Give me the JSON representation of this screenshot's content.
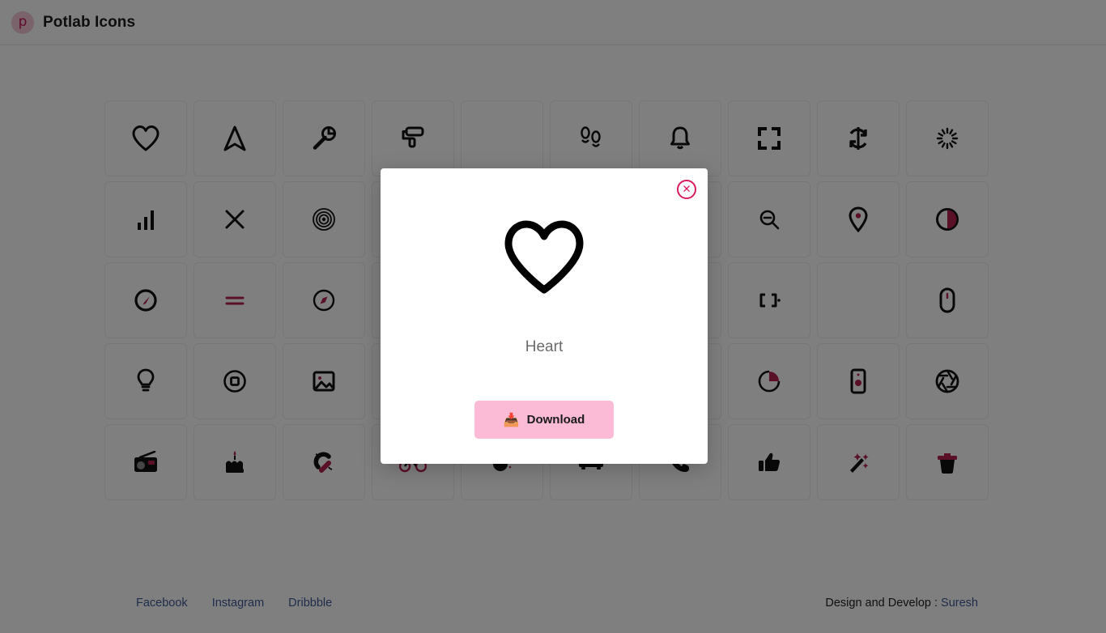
{
  "header": {
    "brand_mark": "p",
    "brand_mark_icon": "potlab-logo-icon",
    "title": "Potlab Icons"
  },
  "colors": {
    "accent_pink": "#d81b60",
    "button_pink": "#fbbbd6",
    "link_blue": "#3d5a99",
    "icon_dark": "#111111",
    "logo_bg": "#f4c6d4"
  },
  "grid": {
    "columns": 10,
    "rows": 5,
    "cells": [
      {
        "name": "heart-icon",
        "icon": "heart"
      },
      {
        "name": "navigation-icon",
        "icon": "navigation"
      },
      {
        "name": "wrench-icon",
        "icon": "wrench"
      },
      {
        "name": "paint-roller-icon",
        "icon": "paint-roller"
      },
      {
        "name": "empty-cell",
        "icon": "none"
      },
      {
        "name": "footprints-icon",
        "icon": "footprints"
      },
      {
        "name": "bell-icon",
        "icon": "bell"
      },
      {
        "name": "fullscreen-icon",
        "icon": "fullscreen"
      },
      {
        "name": "refresh-icon",
        "icon": "refresh"
      },
      {
        "name": "loading-spinner-icon",
        "icon": "loading"
      },
      {
        "name": "bar-chart-icon",
        "icon": "bar-chart"
      },
      {
        "name": "close-x-icon",
        "icon": "close-x"
      },
      {
        "name": "vinyl-record-icon",
        "icon": "vinyl"
      },
      {
        "name": "hidden-cell",
        "icon": "none"
      },
      {
        "name": "hidden-cell",
        "icon": "none"
      },
      {
        "name": "hidden-cell",
        "icon": "none"
      },
      {
        "name": "hidden-cell",
        "icon": "none"
      },
      {
        "name": "zoom-out-icon",
        "icon": "zoom-out"
      },
      {
        "name": "map-pin-icon",
        "icon": "map-pin"
      },
      {
        "name": "contrast-icon",
        "icon": "contrast"
      },
      {
        "name": "speedometer-icon",
        "icon": "speedometer"
      },
      {
        "name": "equals-icon",
        "icon": "equals"
      },
      {
        "name": "compass-icon",
        "icon": "compass"
      },
      {
        "name": "hidden-cell",
        "icon": "none"
      },
      {
        "name": "hidden-cell",
        "icon": "none"
      },
      {
        "name": "hidden-cell",
        "icon": "none"
      },
      {
        "name": "hidden-cell",
        "icon": "none"
      },
      {
        "name": "code-brackets-icon",
        "icon": "brackets"
      },
      {
        "name": "empty-cell",
        "icon": "none"
      },
      {
        "name": "mouse-icon",
        "icon": "mouse"
      },
      {
        "name": "lightbulb-icon",
        "icon": "bulb"
      },
      {
        "name": "record-stop-icon",
        "icon": "record-stop"
      },
      {
        "name": "image-icon",
        "icon": "image"
      },
      {
        "name": "hidden-cell",
        "icon": "none"
      },
      {
        "name": "hidden-cell",
        "icon": "none"
      },
      {
        "name": "hidden-cell",
        "icon": "none"
      },
      {
        "name": "hidden-cell",
        "icon": "none"
      },
      {
        "name": "pie-chart-icon",
        "icon": "pie-chart"
      },
      {
        "name": "tablet-device-icon",
        "icon": "tablet"
      },
      {
        "name": "aperture-icon",
        "icon": "aperture"
      },
      {
        "name": "radio-icon",
        "icon": "radio"
      },
      {
        "name": "birthday-cake-icon",
        "icon": "cake"
      },
      {
        "name": "magnet-icon",
        "icon": "magnet"
      },
      {
        "name": "bicycle-icon",
        "icon": "bicycle"
      },
      {
        "name": "coffee-icon",
        "icon": "coffee"
      },
      {
        "name": "car-icon",
        "icon": "car"
      },
      {
        "name": "phone-icon",
        "icon": "phone"
      },
      {
        "name": "thumbs-up-icon",
        "icon": "thumbs-up"
      },
      {
        "name": "magic-wand-icon",
        "icon": "magic-wand"
      },
      {
        "name": "trash-icon",
        "icon": "trash"
      }
    ]
  },
  "modal": {
    "close_label": "✕",
    "icon_name": "heart",
    "label": "Heart",
    "download_label": "Download",
    "download_icon": "📥"
  },
  "footer": {
    "social": [
      {
        "label": "Facebook"
      },
      {
        "label": "Instagram"
      },
      {
        "label": "Dribbble"
      }
    ],
    "credit_prefix": "Design and Develop : ",
    "credit_name": "Suresh"
  }
}
